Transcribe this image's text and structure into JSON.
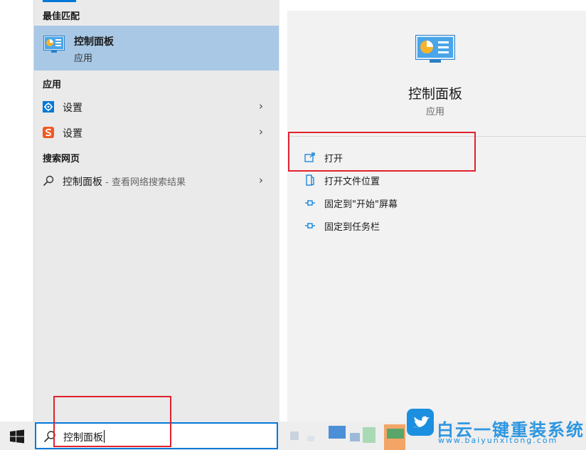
{
  "left_panel": {
    "best_match_header": "最佳匹配",
    "best_match": {
      "title": "控制面板",
      "subtitle": "应用"
    },
    "apps_header": "应用",
    "apps": [
      {
        "label": "设置",
        "icon": "gear-icon"
      },
      {
        "label": "设置",
        "icon": "sogou-s-icon"
      }
    ],
    "web_header": "搜索网页",
    "web_result": {
      "label": "控制面板",
      "hint": " - 查看网络搜索结果"
    }
  },
  "right_panel": {
    "title": "控制面板",
    "subtitle": "应用",
    "actions": [
      {
        "label": "打开",
        "icon": "open-icon"
      },
      {
        "label": "打开文件位置",
        "icon": "file-location-icon"
      },
      {
        "label": "固定到\"开始\"屏幕",
        "icon": "pin-icon"
      },
      {
        "label": "固定到任务栏",
        "icon": "pin-icon"
      }
    ]
  },
  "taskbar": {
    "search_value": "控制面板"
  },
  "watermark": {
    "main": "白云一键重装系统",
    "url": "www.baiyunxitong.com"
  },
  "colors": {
    "accent": "#0078d7",
    "highlight": "#e0222e",
    "selected_row": "#a8c8e6"
  }
}
